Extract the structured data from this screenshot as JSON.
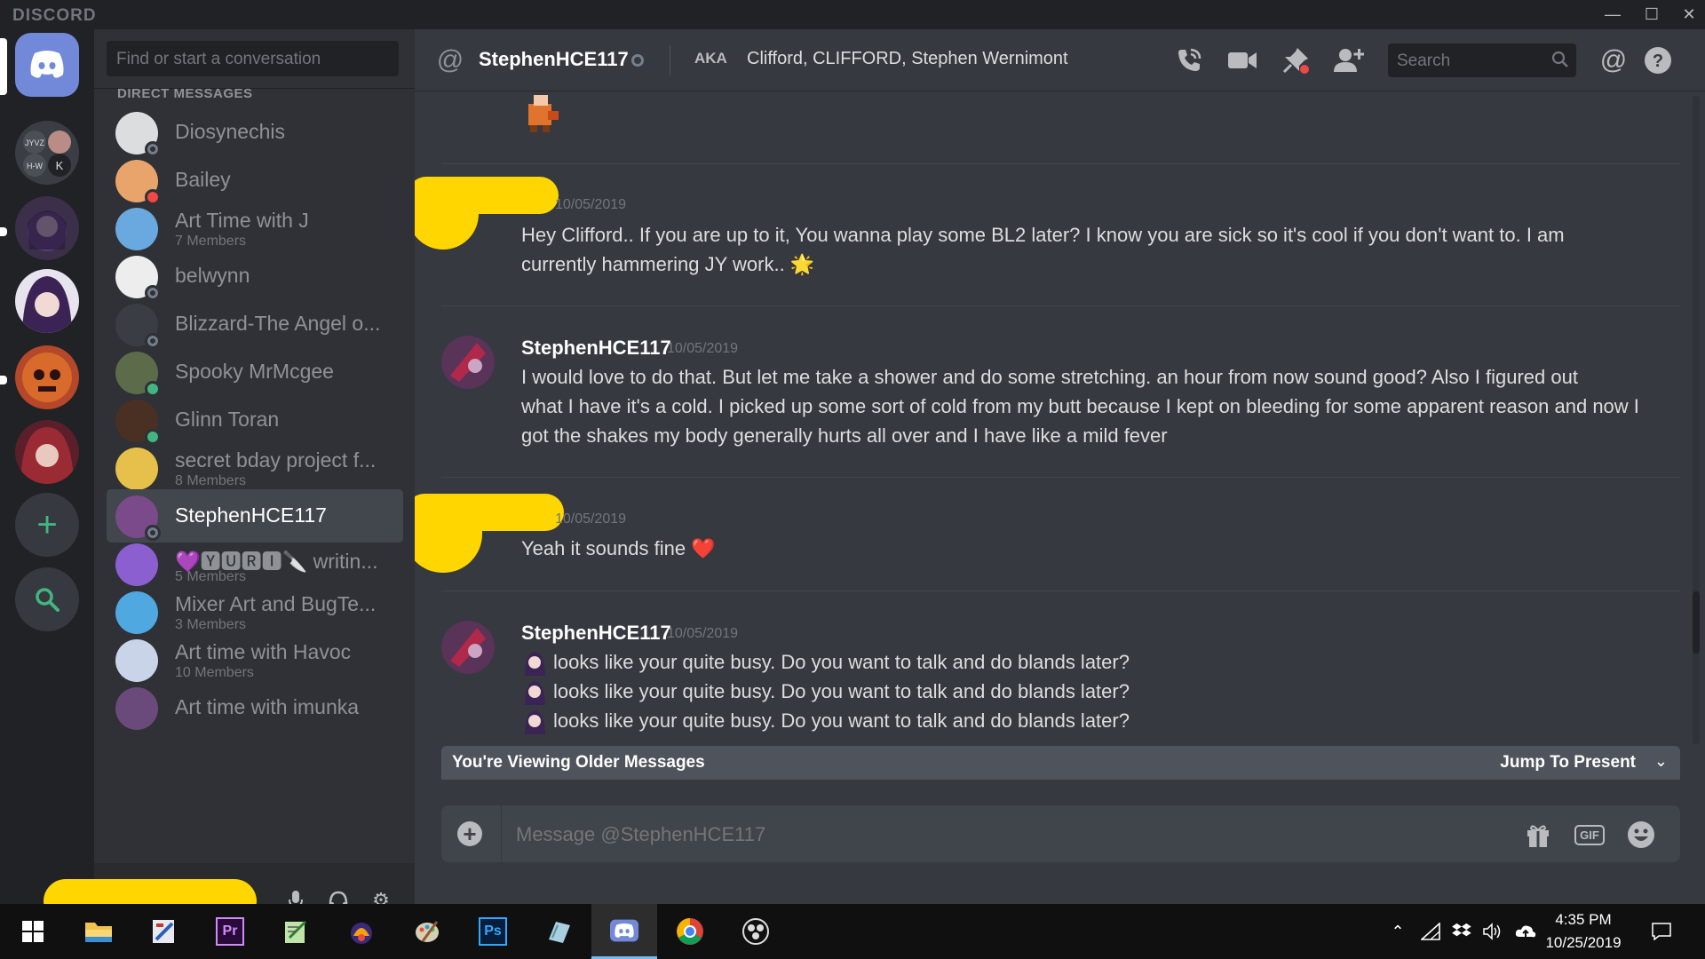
{
  "app": {
    "brand": "DISCORD",
    "window_controls": [
      "minimize",
      "maximize",
      "close"
    ]
  },
  "dm_sidebar": {
    "search_placeholder": "Find or start a conversation",
    "heading": "DIRECT MESSAGES",
    "items": [
      {
        "name": "Diosynechis",
        "sub": "",
        "status": "offline"
      },
      {
        "name": "Bailey",
        "sub": "",
        "status": "dnd"
      },
      {
        "name": "Art Time with J",
        "sub": "7 Members",
        "status": ""
      },
      {
        "name": "belwynn",
        "sub": "",
        "status": "offline"
      },
      {
        "name": "Blizzard-The Angel o...",
        "sub": "",
        "status": "offline"
      },
      {
        "name": "Spooky MrMcgee",
        "sub": "",
        "status": "online"
      },
      {
        "name": "Glinn Toran",
        "sub": "",
        "status": "online"
      },
      {
        "name": "secret bday project f...",
        "sub": "8 Members",
        "status": ""
      },
      {
        "name": "StephenHCE117",
        "sub": "",
        "status": "offline",
        "active": true
      },
      {
        "name": "💜🆈🆄🆁🅸🔪 writin...",
        "sub": "5 Members",
        "status": ""
      },
      {
        "name": "Mixer Art and BugTe...",
        "sub": "3 Members",
        "status": ""
      },
      {
        "name": "Art time with Havoc",
        "sub": "10 Members",
        "status": ""
      },
      {
        "name": "Art time with imunka",
        "sub": "",
        "status": ""
      }
    ]
  },
  "chat_header": {
    "username": "StephenHCE117",
    "aka_label": "AKA",
    "aka_names": "Clifford, CLIFFORD, Stephen Wernimont",
    "search_placeholder": "Search"
  },
  "messages": [
    {
      "author": "",
      "time": "10/05/2019",
      "lines": [
        "Hey Clifford.. If you are up to it, You wanna play some BL2 later? I know you are sick so it's cool if you don't want to. I am",
        "currently hammering JY work.. 🌟"
      ]
    },
    {
      "author": "StephenHCE117",
      "time": "10/05/2019",
      "lines": [
        "I would love to do that. But let me take a shower and do some stretching.  an hour from now sound good?  Also I figured out",
        "what I have it's a cold. I picked up some sort of cold from my butt because I kept on bleeding for some apparent reason and now I",
        "got the shakes my body generally hurts all over and I have like a mild fever"
      ]
    },
    {
      "author": "",
      "time": "10/05/2019",
      "lines": [
        "Yeah it sounds fine ❤️"
      ]
    },
    {
      "author": "StephenHCE117",
      "time": "10/05/2019",
      "lines": [
        "looks like your quite busy. Do you want to talk and do blands later?",
        "looks like your quite busy. Do you want to talk and do blands later?",
        "looks like your quite busy. Do you want to talk and do blands later?"
      ]
    }
  ],
  "older_bar": {
    "text": "You're Viewing Older Messages",
    "jump": "Jump To Present"
  },
  "composer": {
    "placeholder": "Message @StephenHCE117",
    "gif_label": "GIF"
  },
  "colors": {
    "accent": "#7289da",
    "online": "#43b581",
    "dnd": "#f04747",
    "offline": "#747f8d",
    "redaction": "#ffd600"
  },
  "taskbar": {
    "apps": [
      "start-icon",
      "file-explorer-icon",
      "paint-tool-icon",
      "premiere-icon",
      "notepad-icon",
      "game-icon",
      "paint-icon",
      "photoshop-icon",
      "tablet-icon",
      "discord-icon",
      "chrome-icon",
      "obs-icon"
    ],
    "ps_label": "Ps",
    "pr_label": "Pr",
    "time": "4:35 PM",
    "date": "10/25/2019"
  }
}
